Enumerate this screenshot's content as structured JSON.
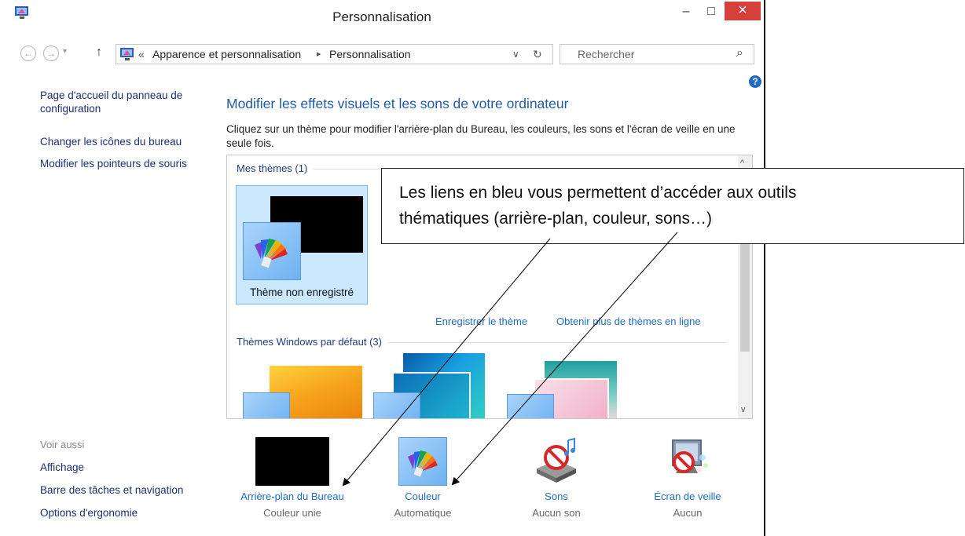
{
  "window": {
    "title": "Personnalisation",
    "minimize": "–",
    "maximize": "□",
    "close": "×"
  },
  "nav": {
    "back": "←",
    "forward": "→",
    "dropdown": "▾",
    "up": "↑",
    "breadcrumb_prefix": "«",
    "breadcrumb_1": "Apparence et personnalisation",
    "breadcrumb_sep": "▸",
    "breadcrumb_2": "Personnalisation",
    "addr_dropdown": "∨",
    "refresh": "↻",
    "search_placeholder": "Rechercher",
    "search_icon": "⌕"
  },
  "sidebar": {
    "home_line1": "Page d'accueil du panneau de",
    "home_line2": "configuration",
    "desktop_icons": "Changer les icônes du bureau",
    "mouse_pointers": "Modifier les pointeurs de souris",
    "see_also": "Voir aussi",
    "display": "Affichage",
    "taskbar": "Barre des tâches et navigation",
    "ease": "Options d'ergonomie"
  },
  "main": {
    "heading": "Modifier les effets visuels et les sons de votre ordinateur",
    "description": "Cliquez sur un thème pour modifier l'arrière-plan du Bureau, les couleurs, les sons et l'écran de veille en une seule fois.",
    "help_icon": "?",
    "my_themes": "Mes thèmes (1)",
    "unsaved_theme": "Thème non enregistré",
    "save_theme": "Enregistrer le thème",
    "more_themes": "Obtenir plus de thèmes en ligne",
    "default_themes": "Thèmes Windows par défaut (3)",
    "scroll_up": "^",
    "scroll_down": "v"
  },
  "bottom": {
    "background_label": "Arrière-plan du Bureau",
    "background_value": "Couleur unie",
    "color_label": "Couleur",
    "color_value": "Automatique",
    "sounds_label": "Sons",
    "sounds_value": "Aucun son",
    "screensaver_label": "Écran de veille",
    "screensaver_value": "Aucun"
  },
  "callout": {
    "line1": "Les liens en bleu vous permettent d’accéder aux outils",
    "line2": "thématiques (arrière-plan, couleur, sons…)"
  },
  "colors": {
    "accent": "#1e6bc4",
    "close": "#d5403a",
    "selection": "#cce8ff"
  }
}
